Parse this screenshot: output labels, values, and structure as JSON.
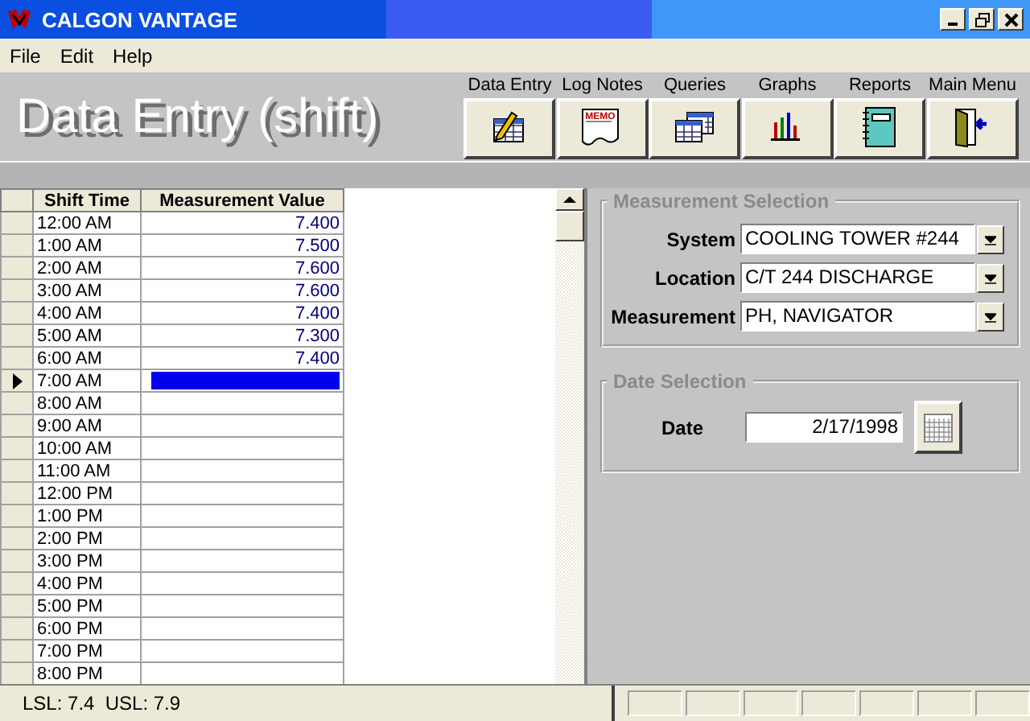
{
  "window": {
    "title": "CALGON VANTAGE"
  },
  "menu": [
    {
      "label": "File"
    },
    {
      "label": "Edit"
    },
    {
      "label": "Help"
    }
  ],
  "header": {
    "title": "Data Entry (shift)"
  },
  "toolbar": [
    {
      "label": "Data Entry",
      "kind": "data-entry"
    },
    {
      "label": "Log Notes",
      "kind": "memo",
      "icon_text": "MEMO"
    },
    {
      "label": "Queries",
      "kind": "queries"
    },
    {
      "label": "Graphs",
      "kind": "graphs"
    },
    {
      "label": "Reports",
      "kind": "reports"
    },
    {
      "label": "Main Menu",
      "kind": "exit"
    }
  ],
  "grid": {
    "columns": [
      {
        "label": "Shift Time"
      },
      {
        "label": "Measurement Value"
      }
    ],
    "rows": [
      {
        "time": "12:00 AM",
        "value": "7.400",
        "selected": false
      },
      {
        "time": "1:00 AM",
        "value": "7.500",
        "selected": false
      },
      {
        "time": "2:00 AM",
        "value": "7.600",
        "selected": false
      },
      {
        "time": "3:00 AM",
        "value": "7.600",
        "selected": false
      },
      {
        "time": "4:00 AM",
        "value": "7.400",
        "selected": false
      },
      {
        "time": "5:00 AM",
        "value": "7.300",
        "selected": false
      },
      {
        "time": "6:00 AM",
        "value": "7.400",
        "selected": false
      },
      {
        "time": "7:00 AM",
        "selected": true
      },
      {
        "time": "8:00 AM",
        "selected": false
      },
      {
        "time": "9:00 AM",
        "selected": false
      },
      {
        "time": "10:00 AM",
        "selected": false
      },
      {
        "time": "11:00 AM",
        "selected": false
      },
      {
        "time": "12:00 PM",
        "selected": false
      },
      {
        "time": "1:00 PM",
        "selected": false
      },
      {
        "time": "2:00 PM",
        "selected": false
      },
      {
        "time": "3:00 PM",
        "selected": false
      },
      {
        "time": "4:00 PM",
        "selected": false
      },
      {
        "time": "5:00 PM",
        "selected": false
      },
      {
        "time": "6:00 PM",
        "selected": false
      },
      {
        "time": "7:00 PM",
        "selected": false
      },
      {
        "time": "8:00 PM",
        "selected": false
      }
    ]
  },
  "measurement_selection": {
    "title": "Measurement Selection",
    "fields": [
      {
        "label": "System",
        "value": "COOLING TOWER #244"
      },
      {
        "label": "Location",
        "value": "C/T 244 DISCHARGE"
      },
      {
        "label": "Measurement",
        "value": "PH, NAVIGATOR"
      }
    ]
  },
  "date_selection": {
    "title": "Date Selection",
    "label": "Date",
    "value": "2/17/1998"
  },
  "status_bar": {
    "text": "LSL: 7.4  USL: 7.9"
  }
}
